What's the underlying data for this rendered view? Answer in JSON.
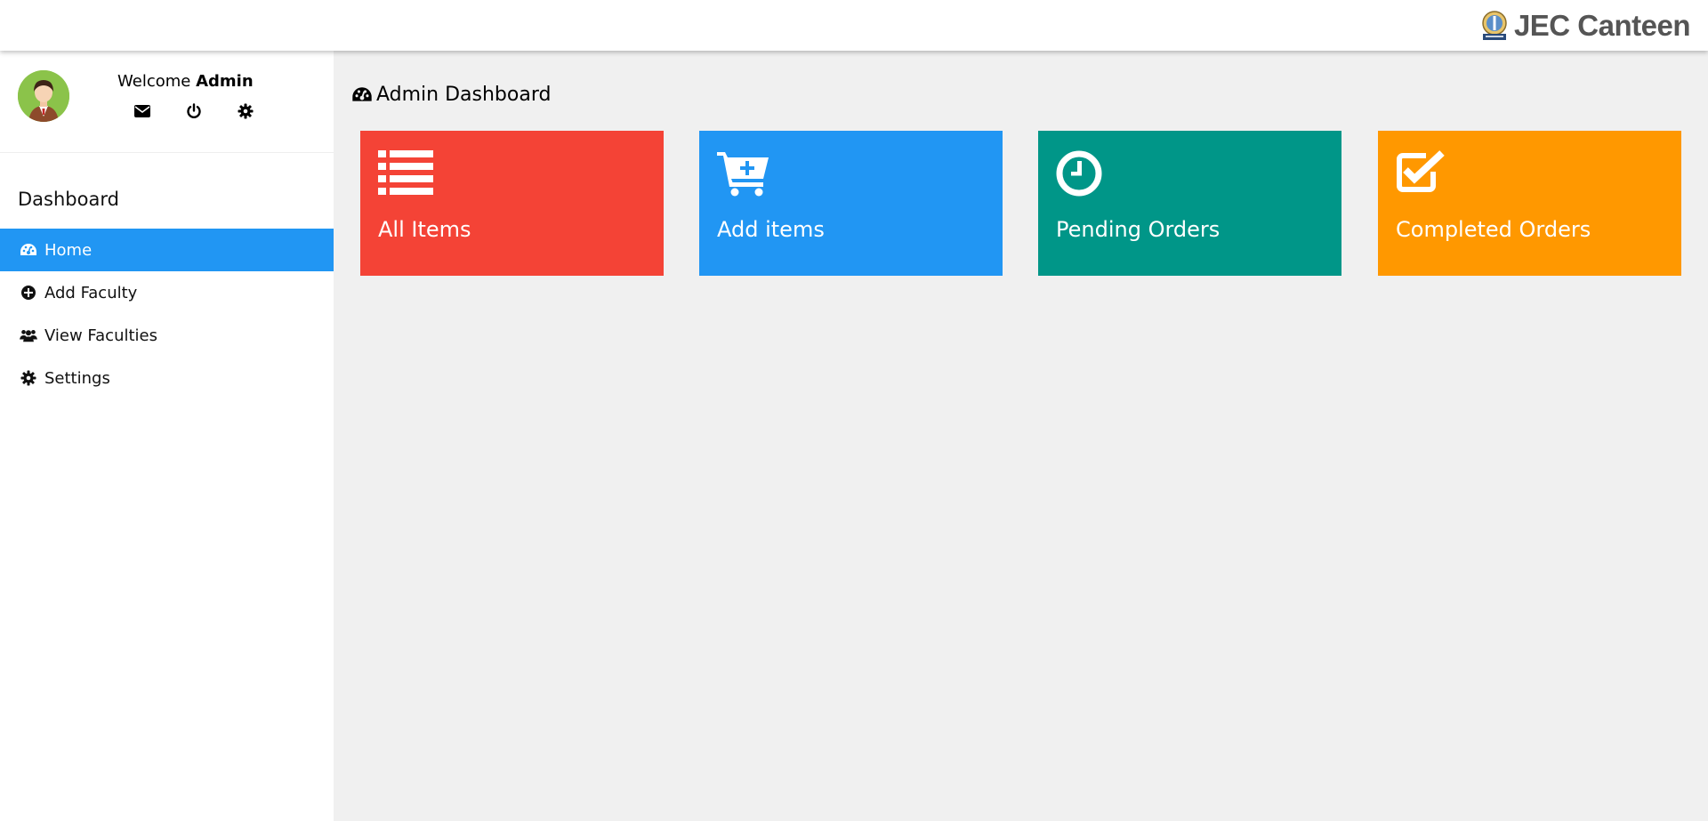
{
  "header": {
    "brand": "JEC Canteen",
    "logo_icon": "college-emblem-icon"
  },
  "user": {
    "welcome_prefix": "Welcome",
    "name": "Admin",
    "avatar_icon": "user-avatar-icon",
    "actions": [
      {
        "icon": "envelope-icon",
        "label": "Messages"
      },
      {
        "icon": "power-icon",
        "label": "Logout"
      },
      {
        "icon": "gear-icon",
        "label": "Settings"
      }
    ]
  },
  "sidebar": {
    "title": "Dashboard",
    "items": [
      {
        "label": "Home",
        "icon": "dashboard-icon",
        "active": true
      },
      {
        "label": "Add Faculty",
        "icon": "plus-circle-icon",
        "active": false
      },
      {
        "label": "View Faculties",
        "icon": "users-icon",
        "active": false
      },
      {
        "label": "Settings",
        "icon": "gear-icon",
        "active": false
      }
    ]
  },
  "main": {
    "title": "Admin Dashboard",
    "title_icon": "dashboard-icon",
    "tiles": [
      {
        "label": "All Items",
        "icon": "list-icon",
        "color": "#f44336"
      },
      {
        "label": "Add items",
        "icon": "cart-plus-icon",
        "color": "#2196f3"
      },
      {
        "label": "Pending Orders",
        "icon": "clock-icon",
        "color": "#009688"
      },
      {
        "label": "Completed Orders",
        "icon": "check-square-icon",
        "color": "#ff9800"
      }
    ]
  },
  "colors": {
    "accent": "#2196f3",
    "background": "#f0f0f0",
    "brand_text": "#555555"
  }
}
